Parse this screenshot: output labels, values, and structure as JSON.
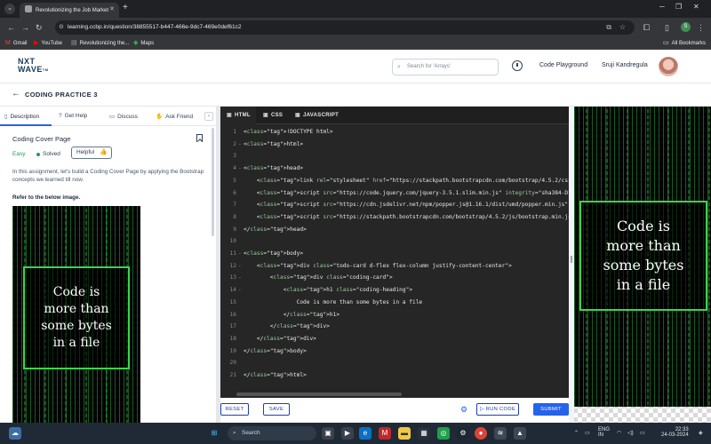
{
  "browser": {
    "tab_title": "Revolutionizing the Job Market",
    "url": "learning.ccbp.in/question/38855517-b447-466e-9dc7-469e0def61c2",
    "bookmarks": [
      {
        "label": "Gmail",
        "icon": "gmail-icon"
      },
      {
        "label": "YouTube",
        "icon": "youtube-icon"
      },
      {
        "label": "Revolutionizing the...",
        "icon": "page-icon"
      },
      {
        "label": "Maps",
        "icon": "maps-icon"
      }
    ],
    "all_bookmarks": "All Bookmarks",
    "profile_initial": "S"
  },
  "header": {
    "logo_line1": "NXT",
    "logo_line2": "WAVE",
    "logo_tm": "TM",
    "search_placeholder": "Search for 'Arrays'",
    "code_playground": "Code Playground",
    "user_name": "Sruji Kandregula"
  },
  "subheader": {
    "title": "CODING PRACTICE 3"
  },
  "left_panel": {
    "tabs": [
      {
        "label": "Description",
        "icon": "document-icon"
      },
      {
        "label": "Get Help",
        "icon": "help-icon"
      },
      {
        "label": "Discuss",
        "icon": "chat-icon"
      },
      {
        "label": "Ask Friend",
        "icon": "handshake-icon"
      }
    ],
    "question_title": "Coding Cover Page",
    "difficulty": "Easy",
    "status": "Solved",
    "helpful_label": "Helpful",
    "description": "In this assignment, let's build a Coding Cover Page by applying the Bootstrap concepts we learned till now.",
    "refer": "Refer to the below image."
  },
  "preview": {
    "line1": "Code is",
    "line2": "more than",
    "line3": "some bytes",
    "line4": "in a file"
  },
  "editor": {
    "tabs": [
      {
        "label": "HTML",
        "icon": "html5-icon"
      },
      {
        "label": "CSS",
        "icon": "css3-icon"
      },
      {
        "label": "JAVASCRIPT",
        "icon": "js-icon"
      }
    ],
    "lines": [
      {
        "n": "1",
        "fold": "",
        "text": "<!DOCTYPE html>"
      },
      {
        "n": "2",
        "fold": "-",
        "text": "<html>"
      },
      {
        "n": "3",
        "fold": "",
        "text": ""
      },
      {
        "n": "4",
        "fold": "-",
        "text": "<head>"
      },
      {
        "n": "5",
        "fold": "",
        "text": "    <link rel=\"stylesheet\" href=\"https://stackpath.bootstrapcdn.com/bootstrap/4.5.2/css/"
      },
      {
        "n": "6",
        "fold": "",
        "text": "    <script src=\"https://code.jquery.com/jquery-3.5.1.slim.min.js\" integrity=\"sha384-DfX"
      },
      {
        "n": "7",
        "fold": "",
        "text": "    <script src=\"https://cdn.jsdelivr.net/npm/popper.js@1.16.1/dist/umd/popper.min.js\" "
      },
      {
        "n": "8",
        "fold": "",
        "text": "    <script src=\"https://stackpath.bootstrapcdn.com/bootstrap/4.5.2/js/bootstrap.min.js\""
      },
      {
        "n": "9",
        "fold": "",
        "text": "</head>"
      },
      {
        "n": "10",
        "fold": "",
        "text": ""
      },
      {
        "n": "11",
        "fold": "-",
        "text": "<body>"
      },
      {
        "n": "12",
        "fold": "-",
        "text": "    <div class=\"todo-card d-flex flex-column justify-content-center\">"
      },
      {
        "n": "13",
        "fold": "-",
        "text": "        <div class=\"coding-card\">"
      },
      {
        "n": "14",
        "fold": "-",
        "text": "            <h1 class=\"coding-heading\">"
      },
      {
        "n": "15",
        "fold": "",
        "text": "                Code is more than some bytes in a file"
      },
      {
        "n": "16",
        "fold": "",
        "text": "            </h1>"
      },
      {
        "n": "17",
        "fold": "",
        "text": "        </div>"
      },
      {
        "n": "18",
        "fold": "",
        "text": "    </div>"
      },
      {
        "n": "19",
        "fold": "",
        "text": "</body>"
      },
      {
        "n": "20",
        "fold": "",
        "text": ""
      },
      {
        "n": "21",
        "fold": "",
        "text": "</html>"
      }
    ]
  },
  "footer": {
    "reset": "RESET",
    "save": "SAVE",
    "run_code": "RUN CODE",
    "submit": "SUBMIT"
  },
  "taskbar": {
    "search_placeholder": "Search",
    "language": "ENG",
    "region": "IN",
    "time": "22:33",
    "date": "24-03-2024"
  }
}
